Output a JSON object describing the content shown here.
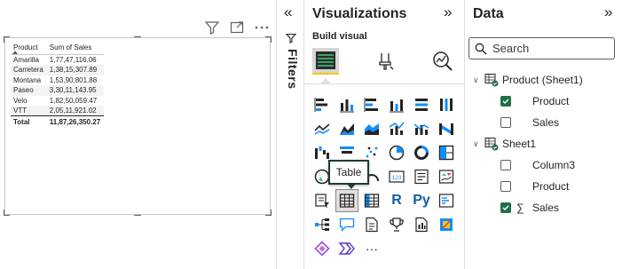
{
  "canvas": {
    "header_icons": [
      "filter-icon",
      "focus-mode-icon",
      "more-options-icon"
    ],
    "table": {
      "columns": [
        "Product",
        "Sum of Sales"
      ],
      "rows": [
        [
          "Amarilla",
          "1,77,47,116.06"
        ],
        [
          "Carretera",
          "1,38,15,307.89"
        ],
        [
          "Montana",
          "1,53,90,801.88"
        ],
        [
          "Paseo",
          "3,30,11,143.95"
        ],
        [
          "Velo",
          "1,82,50,059.47"
        ],
        [
          "VTT",
          "2,05,11,921.02"
        ]
      ],
      "total": [
        "Total",
        "11,87,26,350.27"
      ]
    }
  },
  "filters": {
    "collapse_glyph": "«",
    "label": "Filters"
  },
  "visualizations": {
    "title": "Visualizations",
    "collapse_glyph": "»",
    "build_visual": "Build visual",
    "tooltip": "Table",
    "more_glyph": "···",
    "r_label": "R",
    "py_label": "Py"
  },
  "data_pane": {
    "title": "Data",
    "collapse_glyph": "»",
    "search_placeholder": "Search",
    "tables": [
      {
        "name": "Product (Sheet1)",
        "fields": [
          {
            "name": "Product",
            "checked": true,
            "sigma": false
          },
          {
            "name": "Sales",
            "checked": false,
            "sigma": false
          }
        ]
      },
      {
        "name": "Sheet1",
        "fields": [
          {
            "name": "Column3",
            "checked": false,
            "sigma": false
          },
          {
            "name": "Product",
            "checked": false,
            "sigma": false
          },
          {
            "name": "Sales",
            "checked": true,
            "sigma": true
          }
        ]
      }
    ],
    "sigma_glyph": "∑"
  },
  "colors": {
    "accent_yellow": "#f2c811",
    "check_green": "#1e7145",
    "tooltip_border": "#1e3c2f"
  }
}
